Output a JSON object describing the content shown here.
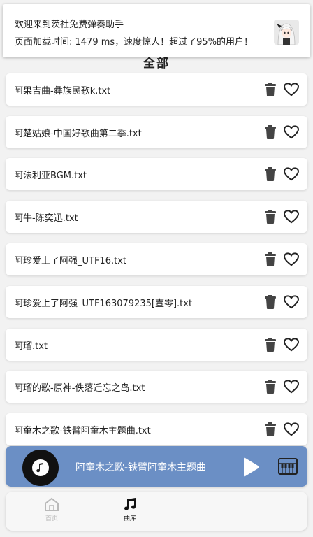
{
  "notification": {
    "line1": "欢迎来到茨社免费弹奏助手",
    "line2": "页面加载时间: 1479 ms，速度惊人！超过了95%的用户！",
    "avatar_icon": "anime-avatar"
  },
  "section_title": "全部",
  "songs": [
    "阿果吉曲-彝族民歌k.txt",
    "阿楚姑娘-中国好歌曲第二季.txt",
    "阿法利亚BGM.txt",
    "阿牛-陈奕迅.txt",
    "阿珍爱上了阿强_UTF16.txt",
    "阿珍爱上了阿强_UTF163079235[壹零].txt",
    "阿瑠.txt",
    "阿瑠的歌-原神-佚落迁忘之岛.txt",
    "阿童木之歌-铁臂阿童木主题曲.txt"
  ],
  "player": {
    "title": "阿童木之歌-铁臂阿童木主题曲",
    "accent": "#6b8fc5"
  },
  "tabs": {
    "home_label": "首页",
    "library_label": "曲库"
  }
}
